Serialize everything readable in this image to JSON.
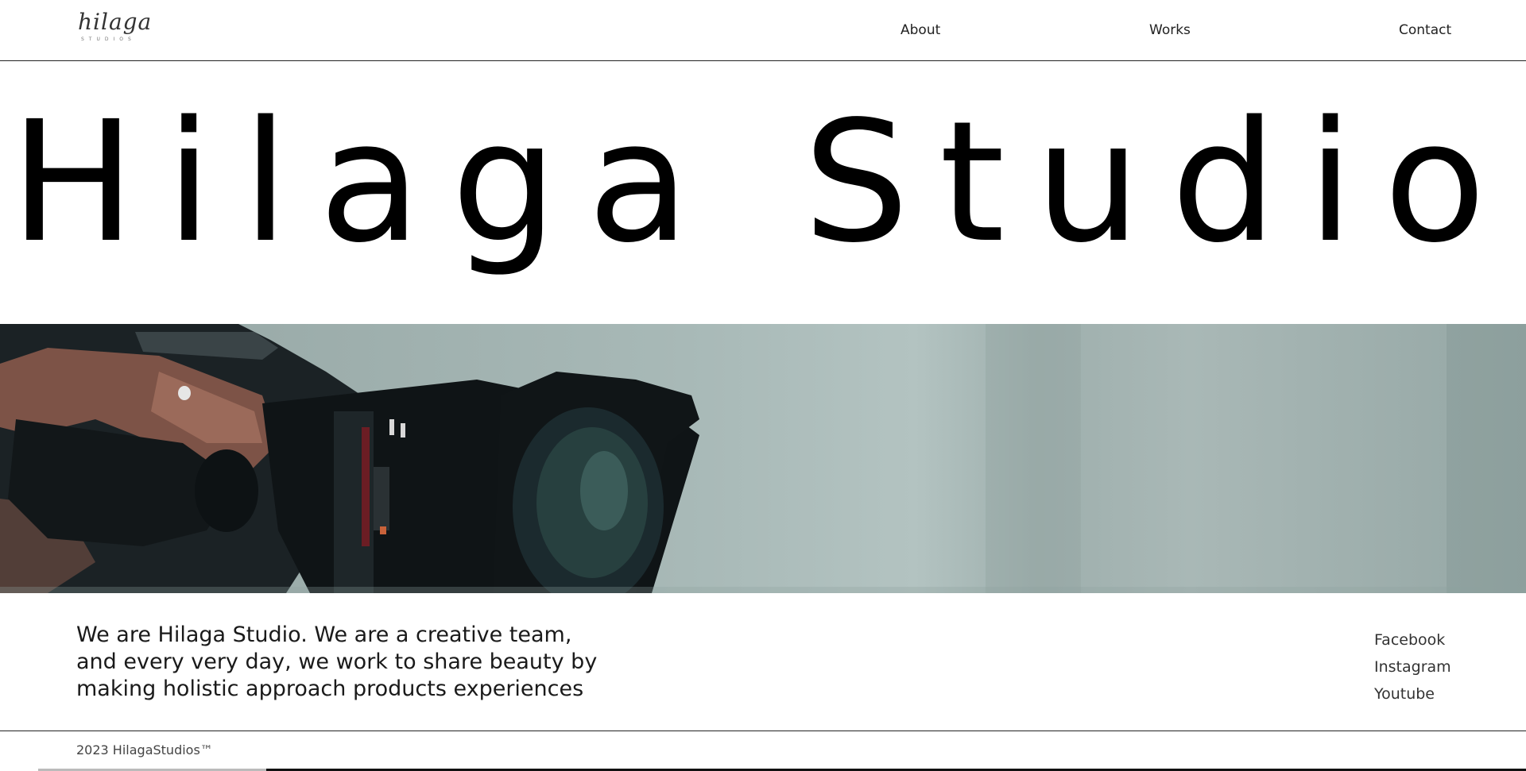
{
  "header": {
    "logo_text": "hilaga",
    "logo_subtext": "STUDIOS",
    "nav": {
      "about": "About",
      "works": "Works",
      "contact": "Contact"
    }
  },
  "hero": {
    "title": "Hilaga Studio"
  },
  "banner": {
    "image": "camera-lens-photo"
  },
  "intro": {
    "lines": [
      "We are Hilaga Studio. We are a creative team,",
      "and every very day, we work to share beauty by",
      "making holistic approach products experiences"
    ]
  },
  "social": {
    "facebook": "Facebook",
    "instagram": "Instagram",
    "youtube": "Youtube"
  },
  "footer": {
    "copyright": "2023 HilagaStudios™"
  },
  "colors": {
    "background": "#ffffff",
    "text": "#111111",
    "banner_tint": "#a8b9b7"
  }
}
